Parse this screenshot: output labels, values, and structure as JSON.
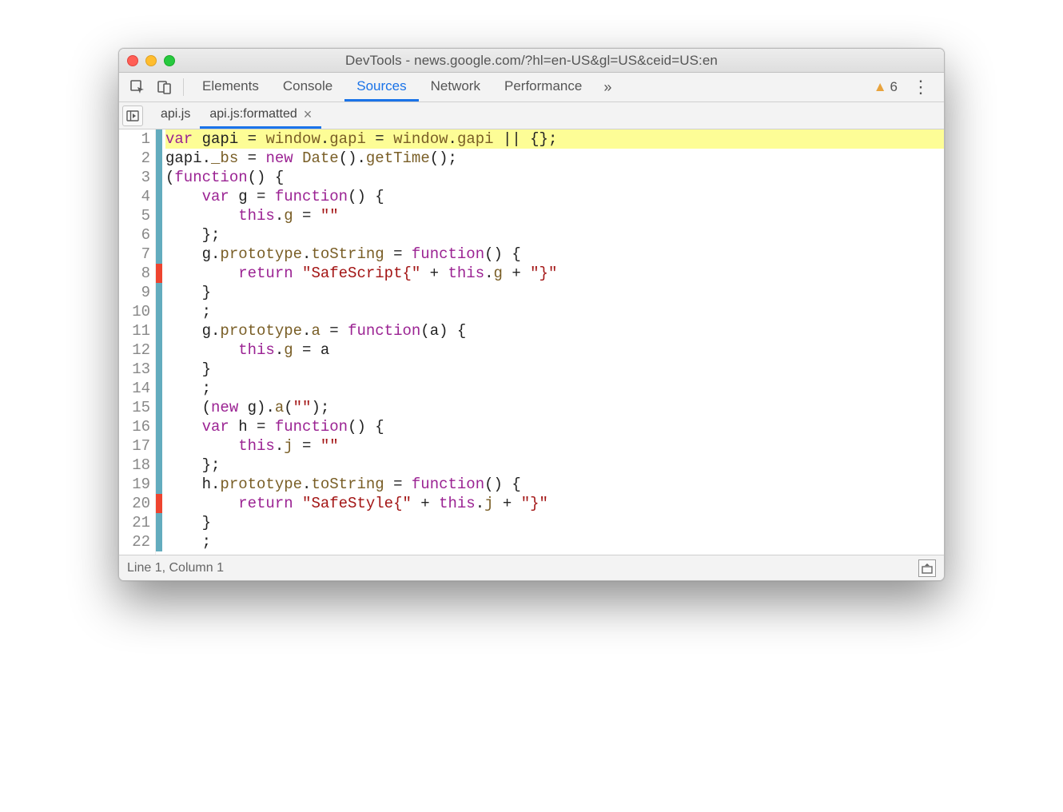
{
  "window": {
    "title": "DevTools - news.google.com/?hl=en-US&gl=US&ceid=US:en"
  },
  "tabs": {
    "items": [
      "Elements",
      "Console",
      "Sources",
      "Network",
      "Performance"
    ],
    "active": "Sources",
    "overflow_glyph": "»",
    "warnings_count": "6",
    "kebab_glyph": "⋮"
  },
  "file_tabs": {
    "items": [
      {
        "label": "api.js",
        "active": false,
        "closable": false
      },
      {
        "label": "api.js:formatted",
        "active": true,
        "closable": true
      }
    ]
  },
  "code": {
    "lines": [
      {
        "n": 1,
        "cov": "blue",
        "hl": true,
        "tokens": [
          [
            "kw",
            "var"
          ],
          [
            "op",
            " gapi "
          ],
          [
            "op",
            "= "
          ],
          [
            "prop",
            "window"
          ],
          [
            "op",
            "."
          ],
          [
            "prop",
            "gapi"
          ],
          [
            "op",
            " = "
          ],
          [
            "prop",
            "window"
          ],
          [
            "op",
            "."
          ],
          [
            "prop",
            "gapi"
          ],
          [
            "op",
            " || {};"
          ]
        ]
      },
      {
        "n": 2,
        "cov": "blue",
        "hl": false,
        "tokens": [
          [
            "op",
            "gapi"
          ],
          [
            "op",
            "."
          ],
          [
            "prop",
            "_bs"
          ],
          [
            "op",
            " = "
          ],
          [
            "kw",
            "new"
          ],
          [
            "op",
            " "
          ],
          [
            "prop",
            "Date"
          ],
          [
            "op",
            "()."
          ],
          [
            "prop",
            "getTime"
          ],
          [
            "op",
            "();"
          ]
        ]
      },
      {
        "n": 3,
        "cov": "blue",
        "hl": false,
        "tokens": [
          [
            "op",
            "("
          ],
          [
            "kw",
            "function"
          ],
          [
            "op",
            "() {"
          ]
        ]
      },
      {
        "n": 4,
        "cov": "blue",
        "hl": false,
        "tokens": [
          [
            "op",
            "    "
          ],
          [
            "kw",
            "var"
          ],
          [
            "op",
            " g = "
          ],
          [
            "kw",
            "function"
          ],
          [
            "op",
            "() {"
          ]
        ]
      },
      {
        "n": 5,
        "cov": "blue",
        "hl": false,
        "tokens": [
          [
            "op",
            "        "
          ],
          [
            "kw",
            "this"
          ],
          [
            "op",
            "."
          ],
          [
            "prop",
            "g"
          ],
          [
            "op",
            " = "
          ],
          [
            "str",
            "\"\""
          ]
        ]
      },
      {
        "n": 6,
        "cov": "blue",
        "hl": false,
        "tokens": [
          [
            "op",
            "    };"
          ]
        ]
      },
      {
        "n": 7,
        "cov": "blue",
        "hl": false,
        "tokens": [
          [
            "op",
            "    g."
          ],
          [
            "prop",
            "prototype"
          ],
          [
            "op",
            "."
          ],
          [
            "prop",
            "toString"
          ],
          [
            "op",
            " = "
          ],
          [
            "kw",
            "function"
          ],
          [
            "op",
            "() {"
          ]
        ]
      },
      {
        "n": 8,
        "cov": "red",
        "hl": false,
        "tokens": [
          [
            "op",
            "        "
          ],
          [
            "kw",
            "return"
          ],
          [
            "op",
            " "
          ],
          [
            "str",
            "\"SafeScript{\""
          ],
          [
            "op",
            " + "
          ],
          [
            "kw",
            "this"
          ],
          [
            "op",
            "."
          ],
          [
            "prop",
            "g"
          ],
          [
            "op",
            " + "
          ],
          [
            "str",
            "\"}\""
          ]
        ]
      },
      {
        "n": 9,
        "cov": "blue",
        "hl": false,
        "tokens": [
          [
            "op",
            "    }"
          ]
        ]
      },
      {
        "n": 10,
        "cov": "blue",
        "hl": false,
        "tokens": [
          [
            "op",
            "    ;"
          ]
        ]
      },
      {
        "n": 11,
        "cov": "blue",
        "hl": false,
        "tokens": [
          [
            "op",
            "    g."
          ],
          [
            "prop",
            "prototype"
          ],
          [
            "op",
            "."
          ],
          [
            "prop",
            "a"
          ],
          [
            "op",
            " = "
          ],
          [
            "kw",
            "function"
          ],
          [
            "op",
            "(a) {"
          ]
        ]
      },
      {
        "n": 12,
        "cov": "blue",
        "hl": false,
        "tokens": [
          [
            "op",
            "        "
          ],
          [
            "kw",
            "this"
          ],
          [
            "op",
            "."
          ],
          [
            "prop",
            "g"
          ],
          [
            "op",
            " = a"
          ]
        ]
      },
      {
        "n": 13,
        "cov": "blue",
        "hl": false,
        "tokens": [
          [
            "op",
            "    }"
          ]
        ]
      },
      {
        "n": 14,
        "cov": "blue",
        "hl": false,
        "tokens": [
          [
            "op",
            "    ;"
          ]
        ]
      },
      {
        "n": 15,
        "cov": "blue",
        "hl": false,
        "tokens": [
          [
            "op",
            "    ("
          ],
          [
            "kw",
            "new"
          ],
          [
            "op",
            " g)."
          ],
          [
            "prop",
            "a"
          ],
          [
            "op",
            "("
          ],
          [
            "str",
            "\"\""
          ],
          [
            "op",
            ");"
          ]
        ]
      },
      {
        "n": 16,
        "cov": "blue",
        "hl": false,
        "tokens": [
          [
            "op",
            "    "
          ],
          [
            "kw",
            "var"
          ],
          [
            "op",
            " h = "
          ],
          [
            "kw",
            "function"
          ],
          [
            "op",
            "() {"
          ]
        ]
      },
      {
        "n": 17,
        "cov": "blue",
        "hl": false,
        "tokens": [
          [
            "op",
            "        "
          ],
          [
            "kw",
            "this"
          ],
          [
            "op",
            "."
          ],
          [
            "prop",
            "j"
          ],
          [
            "op",
            " = "
          ],
          [
            "str",
            "\"\""
          ]
        ]
      },
      {
        "n": 18,
        "cov": "blue",
        "hl": false,
        "tokens": [
          [
            "op",
            "    };"
          ]
        ]
      },
      {
        "n": 19,
        "cov": "blue",
        "hl": false,
        "tokens": [
          [
            "op",
            "    h."
          ],
          [
            "prop",
            "prototype"
          ],
          [
            "op",
            "."
          ],
          [
            "prop",
            "toString"
          ],
          [
            "op",
            " = "
          ],
          [
            "kw",
            "function"
          ],
          [
            "op",
            "() {"
          ]
        ]
      },
      {
        "n": 20,
        "cov": "red",
        "hl": false,
        "tokens": [
          [
            "op",
            "        "
          ],
          [
            "kw",
            "return"
          ],
          [
            "op",
            " "
          ],
          [
            "str",
            "\"SafeStyle{\""
          ],
          [
            "op",
            " + "
          ],
          [
            "kw",
            "this"
          ],
          [
            "op",
            "."
          ],
          [
            "prop",
            "j"
          ],
          [
            "op",
            " + "
          ],
          [
            "str",
            "\"}\""
          ]
        ]
      },
      {
        "n": 21,
        "cov": "blue",
        "hl": false,
        "tokens": [
          [
            "op",
            "    }"
          ]
        ]
      },
      {
        "n": 22,
        "cov": "blue",
        "hl": false,
        "tokens": [
          [
            "op",
            "    ;"
          ]
        ]
      }
    ]
  },
  "status": {
    "cursor": "Line 1, Column 1"
  }
}
